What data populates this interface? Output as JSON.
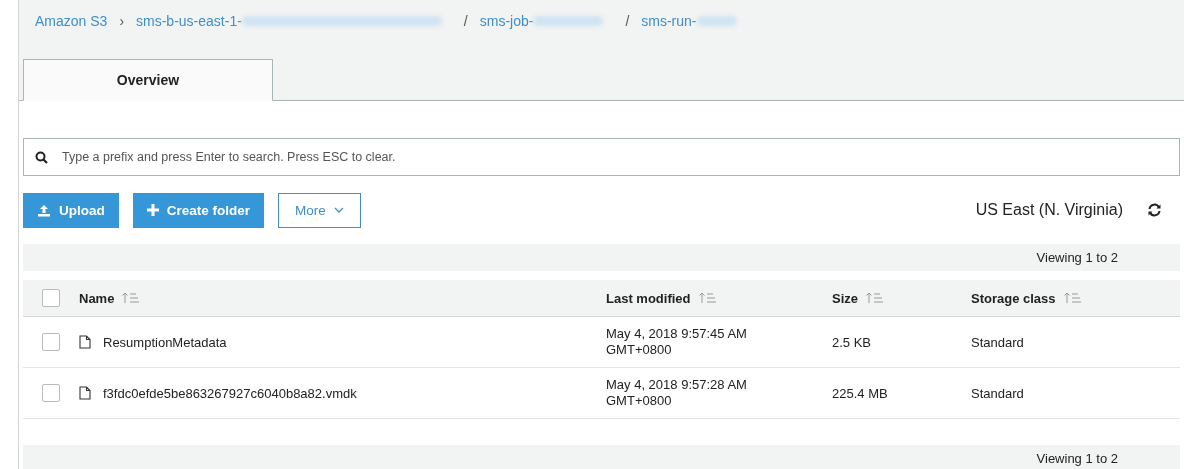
{
  "breadcrumb": [
    {
      "text": "Amazon S3",
      "redacted": false,
      "separator": "›"
    },
    {
      "text": "sms-b-us-east-1-",
      "redacted": true,
      "separator": "/"
    },
    {
      "text": "sms-job-",
      "redacted": true,
      "separator": "/"
    },
    {
      "text": "sms-run-",
      "redacted": true
    }
  ],
  "tabs": [
    {
      "label": "Overview",
      "selected": true
    }
  ],
  "search": {
    "placeholder": "Type a prefix and press Enter to search. Press ESC to clear."
  },
  "toolbar": {
    "upload": "Upload",
    "create_folder": "Create folder",
    "more": "More",
    "region": "US East (N. Virginia)"
  },
  "table": {
    "select_all_checked": false,
    "viewing_top": "Viewing 1 to 2",
    "viewing_bottom": "Viewing 1 to 2",
    "columns": [
      "Name",
      "Last modified",
      "Size",
      "Storage class"
    ],
    "rows": [
      {
        "checked": false,
        "name": "ResumptionMetadata",
        "modified": [
          "May 4, 2018 9:57:45 AM",
          "GMT+0800"
        ],
        "size": "2.5 KB",
        "storage": "Standard"
      },
      {
        "checked": false,
        "name": "f3fdc0efde5be863267927c6040b8a82.vmdk",
        "modified": [
          "May 4, 2018 9:57:28 AM",
          "GMT+0800"
        ],
        "size": "225.4 MB",
        "storage": "Standard"
      }
    ]
  }
}
